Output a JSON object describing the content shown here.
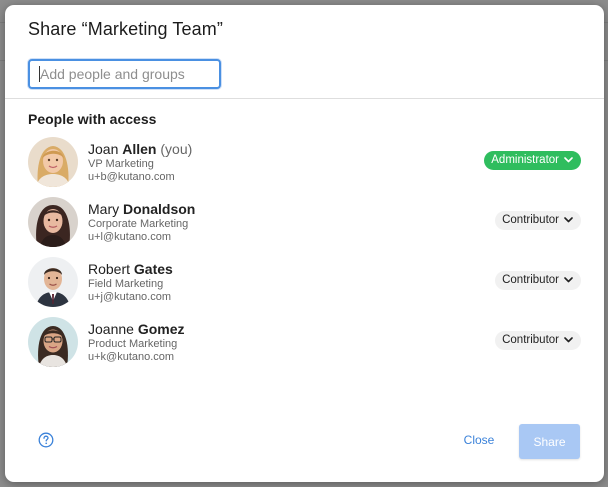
{
  "dialog": {
    "title": "Share “Marketing Team”"
  },
  "search": {
    "placeholder": "Add people and groups",
    "value": ""
  },
  "access": {
    "heading": "People with access",
    "people": [
      {
        "first": "Joan",
        "last": "Allen",
        "suffix": "(you)",
        "title": "VP Marketing",
        "email": "u+b@kutano.com",
        "role": "Administrator",
        "role_style": "admin",
        "avatar": "avatar-joan-allen"
      },
      {
        "first": "Mary",
        "last": "Donaldson",
        "suffix": "",
        "title": "Corporate Marketing",
        "email": "u+l@kutano.com",
        "role": "Contributor",
        "role_style": "contrib",
        "avatar": "avatar-mary-donaldson"
      },
      {
        "first": "Robert",
        "last": "Gates",
        "suffix": "",
        "title": "Field Marketing",
        "email": "u+j@kutano.com",
        "role": "Contributor",
        "role_style": "contrib",
        "avatar": "avatar-robert-gates"
      },
      {
        "first": "Joanne",
        "last": "Gomez",
        "suffix": "",
        "title": "Product Marketing",
        "email": "u+k@kutano.com",
        "role": "Contributor",
        "role_style": "contrib",
        "avatar": "avatar-joanne-gomez"
      }
    ]
  },
  "footer": {
    "help_icon": "question-circle-icon",
    "close_label": "Close",
    "share_label": "Share"
  },
  "colors": {
    "accent": "#3b82d9",
    "admin_badge": "#2fbd5e",
    "contributor_badge": "#f1f1f1",
    "share_disabled": "#a9c8f4"
  }
}
